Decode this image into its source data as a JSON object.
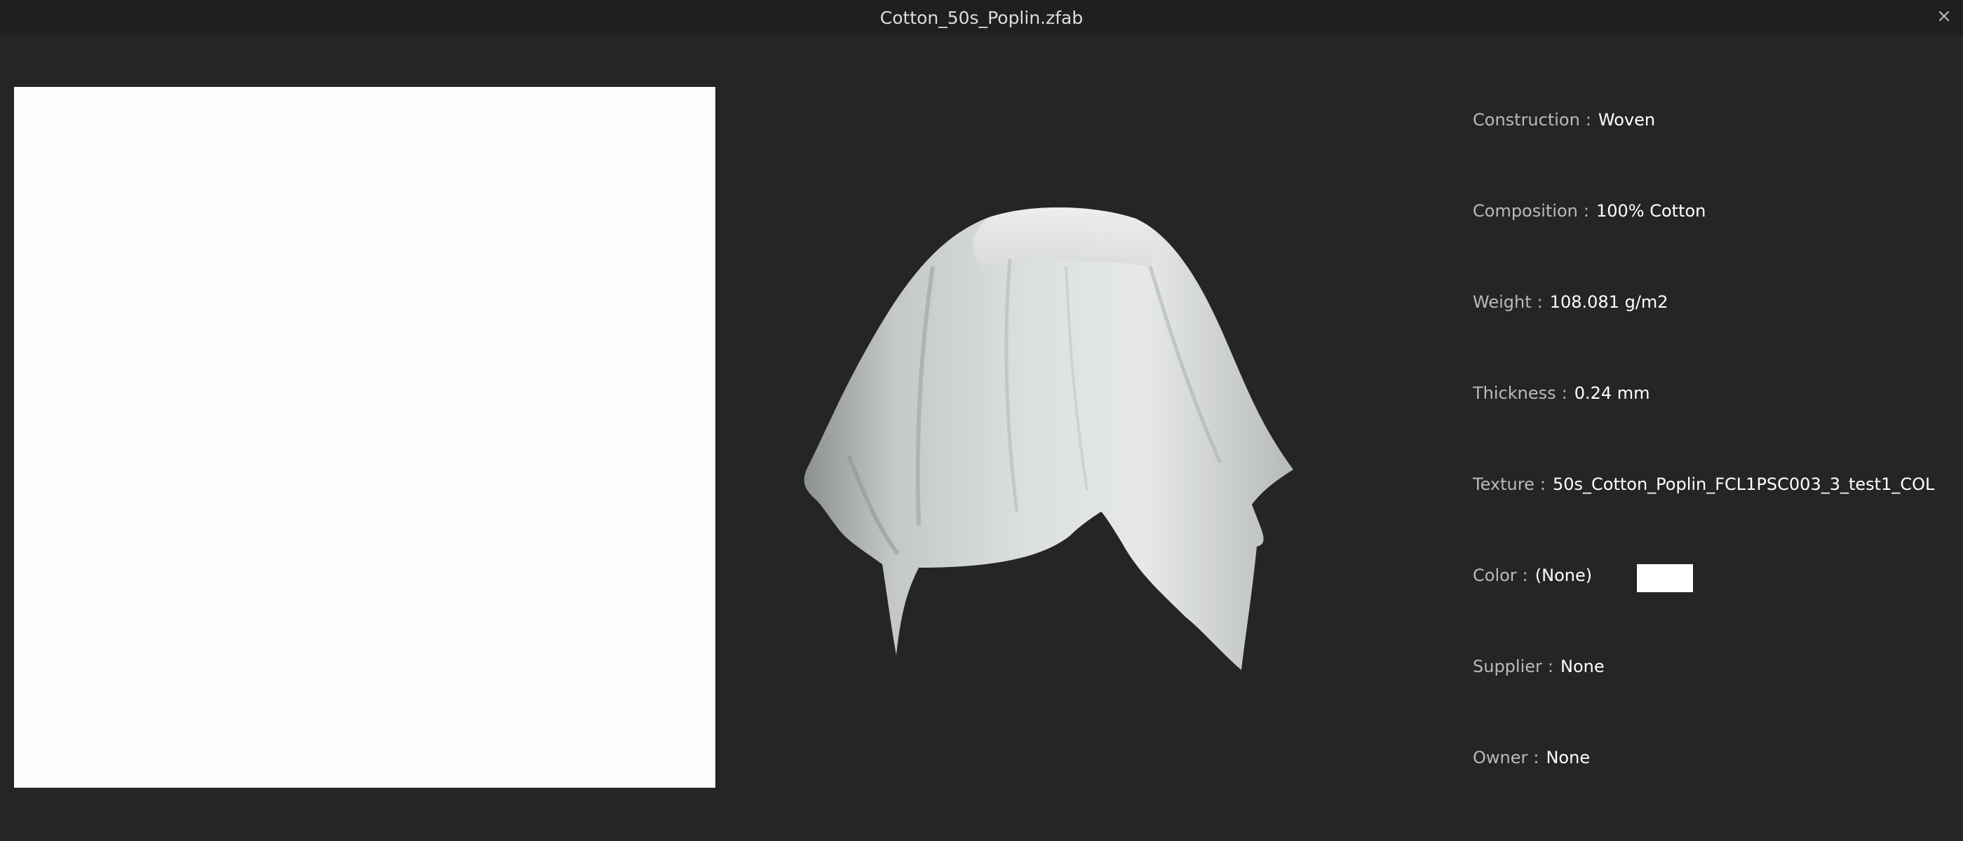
{
  "window": {
    "title": "Cotton_50s_Poplin.zfab",
    "close_glyph": "×",
    "close_icon": "close-icon"
  },
  "properties": [
    {
      "label": "Construction",
      "sep": ":",
      "value": "Woven"
    },
    {
      "label": "Composition",
      "sep": ":",
      "value": "100% Cotton"
    },
    {
      "label": "Weight",
      "sep": ":",
      "value": "108.081 g/m2"
    },
    {
      "label": "Thickness",
      "sep": ":",
      "value": "0.24 mm"
    },
    {
      "label": "Texture",
      "sep": ":",
      "value": "50s_Cotton_Poplin_FCL1PSC003_3_test1_COL"
    },
    {
      "label": "Color",
      "sep": ":",
      "value": "(None)"
    },
    {
      "label": "Supplier",
      "sep": ":",
      "value": "None"
    },
    {
      "label": "Owner",
      "sep": ":",
      "value": "None"
    }
  ],
  "color_swatch_hex": "#ffffff",
  "colors": {
    "background": "#252525",
    "titlebar": "#1f1f1f",
    "label": "#b9b9b9",
    "value": "#ffffff",
    "texture": "#fbfdfc"
  }
}
